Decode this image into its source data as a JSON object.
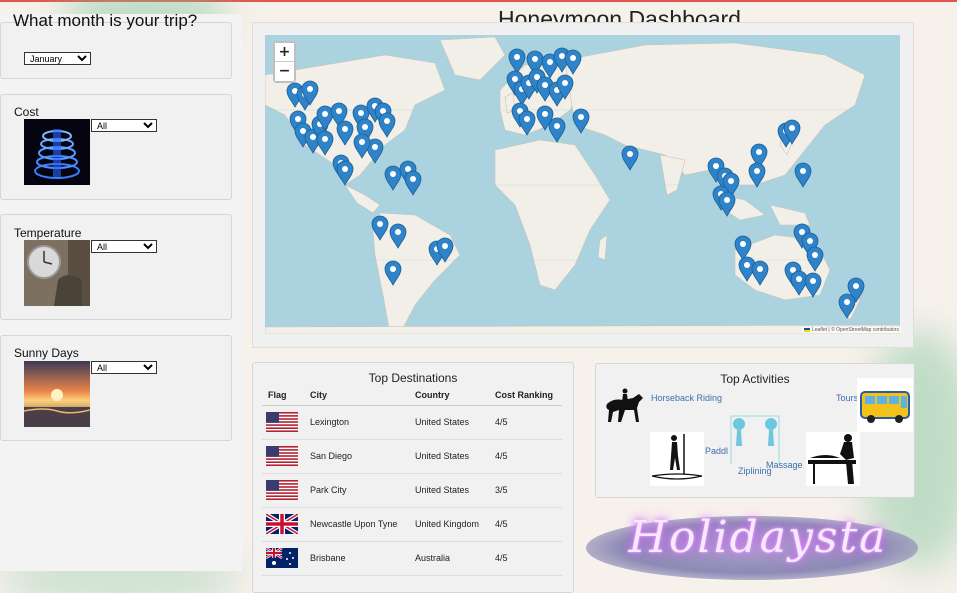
{
  "dashboard": {
    "title": "Honeymoon Dashboard"
  },
  "filters": {
    "month": {
      "label": "What month is your trip?",
      "value": "January"
    },
    "cost": {
      "label": "Cost",
      "value": "All"
    },
    "temperature": {
      "label": "Temperature",
      "value": "All"
    },
    "sunny_days": {
      "label": "Sunny Days",
      "value": "All"
    }
  },
  "map": {
    "zoom_in": "+",
    "zoom_out": "−",
    "attribution": "Leaflet | © OpenStreetMap contributors"
  },
  "destinations": {
    "title": "Top Destinations",
    "headers": [
      "Flag",
      "City",
      "Country",
      "Cost Ranking"
    ],
    "rows": [
      {
        "flag": "us",
        "city": "Lexington",
        "country": "United States",
        "cost": "4/5"
      },
      {
        "flag": "us",
        "city": "San Diego",
        "country": "United States",
        "cost": "4/5"
      },
      {
        "flag": "us",
        "city": "Park City",
        "country": "United States",
        "cost": "3/5"
      },
      {
        "flag": "uk",
        "city": "Newcastle Upon Tyne",
        "country": "United Kingdom",
        "cost": "4/5"
      },
      {
        "flag": "au",
        "city": "Brisbane",
        "country": "Australia",
        "cost": "4/5"
      }
    ]
  },
  "activities": {
    "title": "Top Activities",
    "items": [
      "Horseback Riding",
      "Tours",
      "Paddl",
      "Ziplining",
      "Massage"
    ]
  },
  "logo": {
    "text": "Holidaysta"
  },
  "colors": {
    "marker": "#2f83c8",
    "ocean": "#aad3df",
    "land": "#f2efe9",
    "link": "#3a6fb0"
  }
}
